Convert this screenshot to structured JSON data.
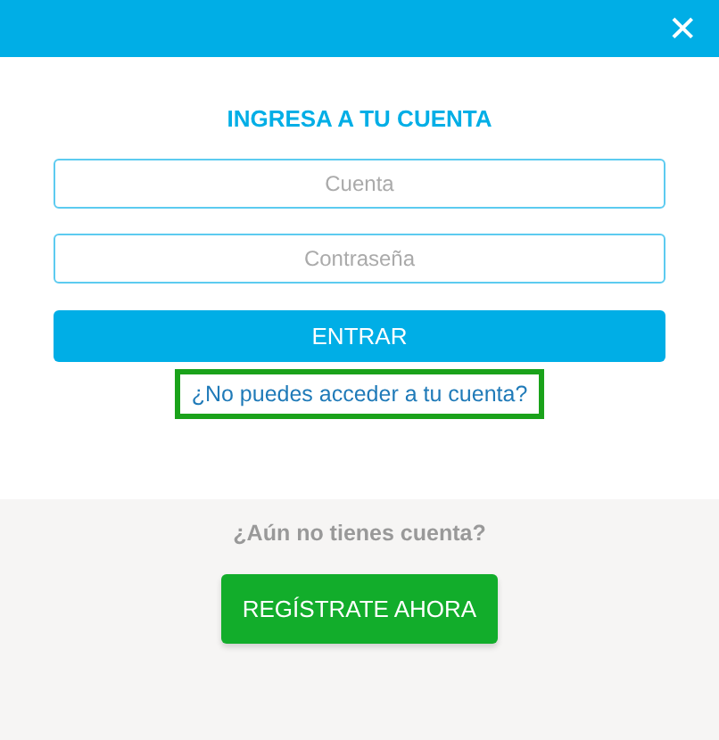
{
  "header": {
    "close": "✕"
  },
  "login": {
    "title": "INGRESA A TU CUENTA",
    "fields": [
      {
        "placeholder": "Cuenta"
      },
      {
        "placeholder": "Contraseña"
      }
    ],
    "submit": "ENTRAR",
    "forgot_link": {
      "label": "¿No puedes acceder a tu cuenta?",
      "selected": true
    }
  },
  "register": {
    "prompt": "¿Aún no tienes cuenta?",
    "button": "REGÍSTRATE AHORA"
  }
}
